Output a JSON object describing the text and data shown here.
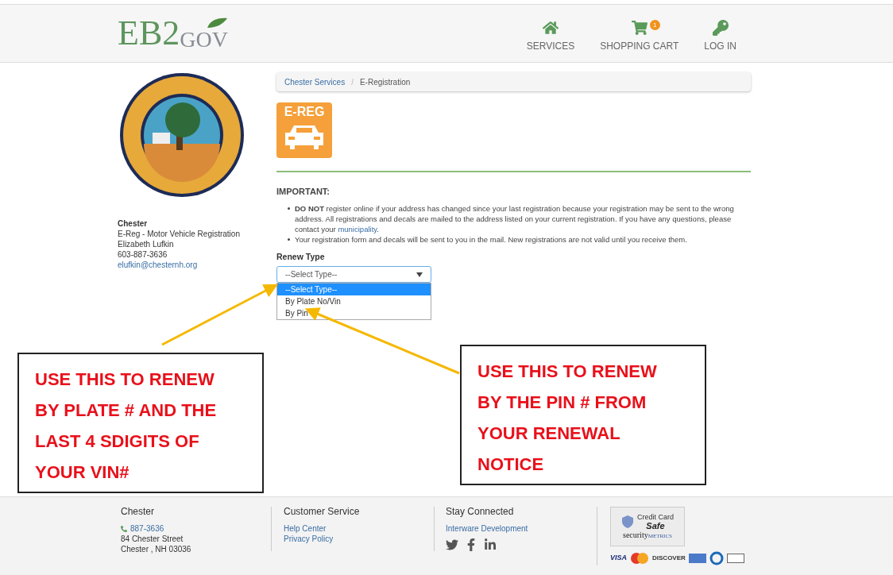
{
  "header": {
    "logo": {
      "main": "EB2",
      "sub": "GOV"
    },
    "nav": [
      {
        "kind": "home",
        "label": "SERVICES"
      },
      {
        "kind": "cart",
        "label": "SHOPPING CART",
        "badge": "1"
      },
      {
        "kind": "key",
        "label": "LOG IN"
      }
    ]
  },
  "sidebar": {
    "name": "Chester",
    "lines": [
      "E-Reg - Motor Vehicle Registration",
      "Elizabeth Lufkin",
      "603-887-3636"
    ],
    "email": "elufkin@chesternh.org"
  },
  "breadcrumb": [
    "Chester Services",
    "/",
    "E-Registration"
  ],
  "ereg_icon": {
    "label": "E-REG"
  },
  "notice": {
    "title": "IMPORTANT:",
    "items": [
      "**DO NOT** register online if your address has changed since your last registration because your registration may be sent to the wrong address. All registrations and decals are mailed to the address listed on your current registration. If you have any questions, please contact your",
      "Your registration form and decals will be sent to you in the mail. New registrations are not valid until you receive them."
    ],
    "link": "municipality",
    "link_end": "."
  },
  "renew_type": {
    "label": "Renew Type",
    "value": "--Select Type--",
    "expanded": true,
    "options": [
      {
        "label": "--Select Type--",
        "selected": true
      },
      {
        "label": "By Plate No/Vin",
        "selected": false
      },
      {
        "label": "By Pin",
        "selected": false
      }
    ]
  },
  "annotations": [
    "USE THIS TO RENEW BY PLATE # AND THE LAST 4 SDIGITS OF YOUR VIN#",
    "USE THIS TO RENEW BY THE PIN # FROM YOUR RENEWAL NOTICE"
  ],
  "footer": {
    "contact": {
      "title": "Chester",
      "phone": "887-3636",
      "address": [
        "84 Chester Street",
        "Chester , NH 03036"
      ]
    },
    "service": {
      "title": "Customer Service",
      "links": [
        "Help Center",
        "Privacy Policy"
      ]
    },
    "social": {
      "title": "Stay Connected",
      "link": "Interware Development"
    },
    "badge": {
      "line1": "Credit Card",
      "line2": "Safe",
      "brand": "security",
      "brand2": "METRICS"
    },
    "cards": [
      "VISA",
      "DISCOVER"
    ]
  }
}
